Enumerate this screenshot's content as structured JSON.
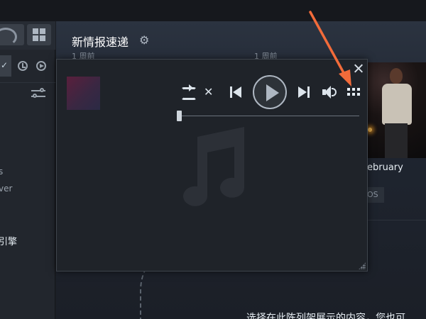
{
  "main": {
    "news_title": "新情报速递",
    "news_date_left": "1 周前",
    "news_date_right": "1 周前",
    "news_caption": "ebruary",
    "news_tag": "OS",
    "bottom_text": "选择在此陈列架展示的内容，您也可"
  },
  "sidebar": {
    "dropdown_glyph": "✓",
    "text_1": "s",
    "text_2": "ver",
    "text_3": "引擎"
  },
  "player": {
    "shuffle_glyph": "✕"
  },
  "colors": {
    "annotation_arrow": "#f26b3a",
    "background": "#1b1e24",
    "player_bg": "#1f2329"
  }
}
